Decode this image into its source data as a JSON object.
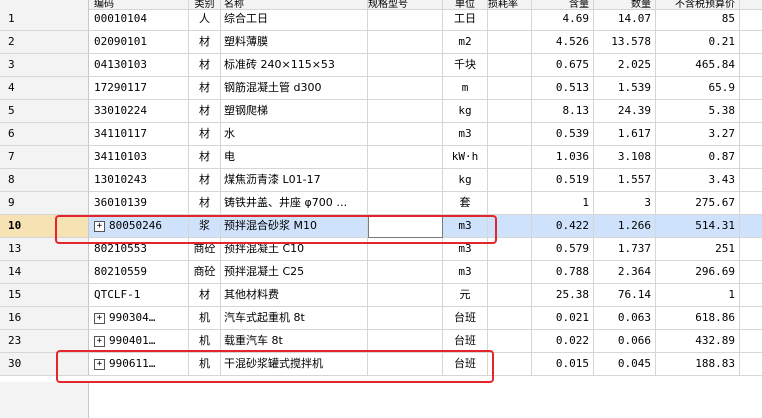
{
  "header": [
    "编码",
    "类别",
    "名称",
    "规格型号",
    "单位",
    "损耗率",
    "含量",
    "数量",
    "不含税预算价",
    ""
  ],
  "rows": [
    {
      "num": "1",
      "code": "00010104",
      "type": "人",
      "name": "综合工日",
      "unit": "工日",
      "qty": "4.69",
      "amt": "14.07",
      "price": "85",
      "expand": false
    },
    {
      "num": "2",
      "code": "02090101",
      "type": "材",
      "name": "塑料薄膜",
      "unit": "m2",
      "qty": "4.526",
      "amt": "13.578",
      "price": "0.21",
      "expand": false
    },
    {
      "num": "3",
      "code": "04130103",
      "type": "材",
      "name": "标准砖 240×115×53",
      "unit": "千块",
      "qty": "0.675",
      "amt": "2.025",
      "price": "465.84",
      "expand": false
    },
    {
      "num": "4",
      "code": "17290117",
      "type": "材",
      "name": "钢筋混凝土管 d300",
      "unit": "m",
      "qty": "0.513",
      "amt": "1.539",
      "price": "65.9",
      "expand": false
    },
    {
      "num": "5",
      "code": "33010224",
      "type": "材",
      "name": "塑钢爬梯",
      "unit": "kg",
      "qty": "8.13",
      "amt": "24.39",
      "price": "5.38",
      "expand": false
    },
    {
      "num": "6",
      "code": "34110117",
      "type": "材",
      "name": "水",
      "unit": "m3",
      "qty": "0.539",
      "amt": "1.617",
      "price": "3.27",
      "expand": false
    },
    {
      "num": "7",
      "code": "34110103",
      "type": "材",
      "name": "电",
      "unit": "kW·h",
      "qty": "1.036",
      "amt": "3.108",
      "price": "0.87",
      "expand": false
    },
    {
      "num": "8",
      "code": "13010243",
      "type": "材",
      "name": "煤焦沥青漆 L01-17",
      "unit": "kg",
      "qty": "0.519",
      "amt": "1.557",
      "price": "3.43",
      "expand": false
    },
    {
      "num": "9",
      "code": "36010139",
      "type": "材",
      "name": "铸铁井盖、井座 φ700 …",
      "unit": "套",
      "qty": "1",
      "amt": "3",
      "price": "275.67",
      "expand": false
    },
    {
      "num": "10",
      "code": "80050246",
      "type": "浆",
      "name": "预拌混合砂浆 M10",
      "unit": "m3",
      "qty": "0.422",
      "amt": "1.266",
      "price": "514.31",
      "expand": true,
      "selected": true
    },
    {
      "num": "13",
      "code": "80210553",
      "type": "商砼",
      "name": "预拌混凝土 C10",
      "unit": "m3",
      "qty": "0.579",
      "amt": "1.737",
      "price": "251",
      "expand": false
    },
    {
      "num": "14",
      "code": "80210559",
      "type": "商砼",
      "name": "预拌混凝土 C25",
      "unit": "m3",
      "qty": "0.788",
      "amt": "2.364",
      "price": "296.69",
      "expand": false
    },
    {
      "num": "15",
      "code": "QTCLF-1",
      "type": "材",
      "name": "其他材料费",
      "unit": "元",
      "qty": "25.38",
      "amt": "76.14",
      "price": "1",
      "expand": false
    },
    {
      "num": "16",
      "code": "990304…",
      "type": "机",
      "name": "汽车式起重机 8t",
      "unit": "台班",
      "qty": "0.021",
      "amt": "0.063",
      "price": "618.86",
      "expand": true
    },
    {
      "num": "23",
      "code": "990401…",
      "type": "机",
      "name": "载重汽车 8t",
      "unit": "台班",
      "qty": "0.022",
      "amt": "0.066",
      "price": "432.89",
      "expand": true
    },
    {
      "num": "30",
      "code": "990611…",
      "type": "机",
      "name": "干混砂浆罐式搅拌机",
      "unit": "台班",
      "qty": "0.015",
      "amt": "0.045",
      "price": "188.83",
      "expand": true
    }
  ],
  "colors": {
    "highlight": "#e3262b",
    "selected_row": "#cfe2fb",
    "selected_num": "#f6e2b3"
  },
  "icons": {
    "expand": "plus-box-icon"
  }
}
